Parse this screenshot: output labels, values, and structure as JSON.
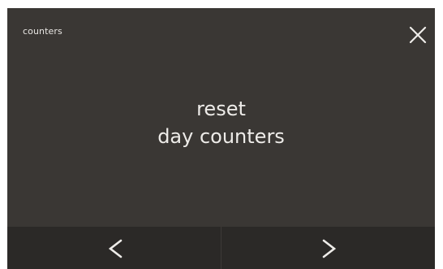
{
  "header": {
    "title": "counters",
    "close_icon": "close-icon"
  },
  "message": {
    "line1": "reset",
    "line2": "day counters"
  },
  "navigation": {
    "prev_icon": "chevron-left-icon",
    "next_icon": "chevron-right-icon"
  },
  "colors": {
    "screen_background": "#3a3734",
    "bottom_bar_background": "#2b2927",
    "text": "#eeece9"
  }
}
